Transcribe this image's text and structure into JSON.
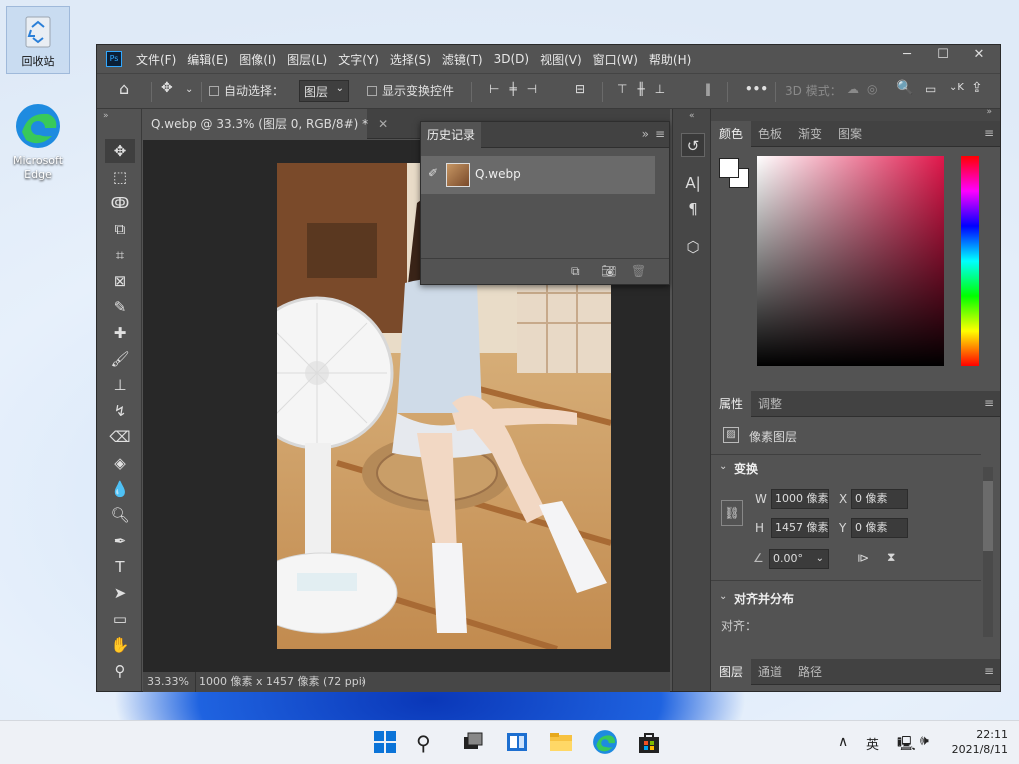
{
  "desktop": {
    "icons": [
      {
        "label": "回收站",
        "name": "recycle-bin-icon"
      },
      {
        "label": "Microsoft Edge",
        "name": "edge-icon"
      }
    ]
  },
  "app": {
    "badge": "Ps",
    "menu": [
      "文件(F)",
      "编辑(E)",
      "图像(I)",
      "图层(L)",
      "文字(Y)",
      "选择(S)",
      "滤镜(T)",
      "3D(D)",
      "视图(V)",
      "窗口(W)",
      "帮助(H)"
    ],
    "window_buttons": {
      "minimize": "─",
      "maximize": "☐",
      "close": "✕"
    }
  },
  "options": {
    "auto_select_label": "自动选择：",
    "auto_select_value": "图层",
    "show_transform_label": "显示变换控件",
    "mode_3d": "3D 模式："
  },
  "document": {
    "tab_title": "Q.webp @ 33.3% (图层 0, RGB/8#) *",
    "zoom": "33.33%",
    "info": "1000 像素 x 1457 像素 (72 ppi)"
  },
  "history": {
    "title": "历史记录",
    "item": "Q.webp"
  },
  "color_panel": {
    "tabs": [
      "颜色",
      "色板",
      "渐变",
      "图案"
    ],
    "accent": "#e0174b"
  },
  "properties": {
    "tabs": [
      "属性",
      "调整"
    ],
    "layer_type": "像素图层",
    "transform_heading": "变换",
    "w_label": "W",
    "w_value": "1000 像素",
    "h_label": "H",
    "h_value": "1457 像素",
    "x_label": "X",
    "x_value": "0 像素",
    "y_label": "Y",
    "y_value": "0 像素",
    "angle_value": "0.00°",
    "align_heading": "对齐并分布",
    "align_label": "对齐："
  },
  "layers": {
    "tabs": [
      "图层",
      "通道",
      "路径"
    ]
  },
  "taskbar": {
    "ime": "英",
    "time": "22:11",
    "date": "2021/8/11"
  }
}
